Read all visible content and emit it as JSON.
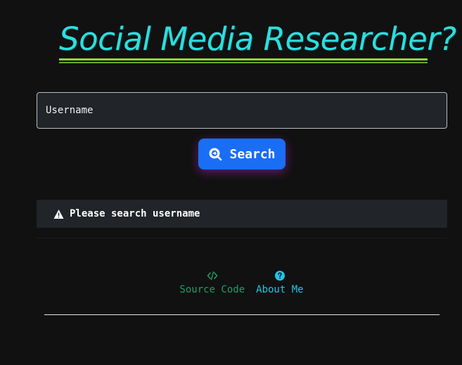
{
  "header": {
    "title": "Social Media Researcher?"
  },
  "search": {
    "placeholder": "Username",
    "value": "",
    "button_label": "Search"
  },
  "alert": {
    "icon": "warning-icon",
    "message": "Please search username"
  },
  "links": [
    {
      "label": "Source Code",
      "icon": "code-icon",
      "color": "#1f9e6a"
    },
    {
      "label": "About Me",
      "icon": "question-icon",
      "color": "#22c4e8"
    }
  ],
  "colors": {
    "background": "#111111",
    "title": "#2ddede",
    "title_underline": "#8bd63c",
    "button": "#1a6ef5",
    "panel": "#212428"
  }
}
